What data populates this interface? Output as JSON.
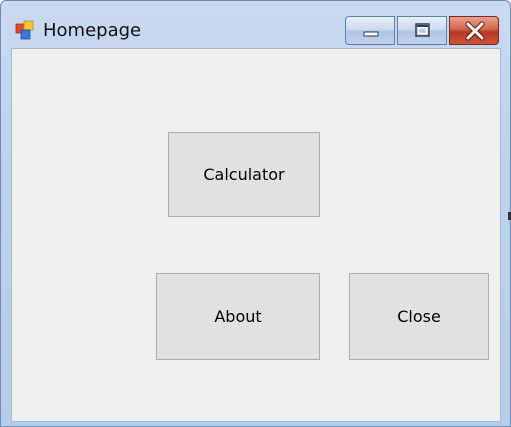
{
  "window": {
    "title": "Homepage"
  },
  "titlebar": {
    "icon": "app-windows-icon",
    "minimize_icon": "minimize-icon",
    "maximize_icon": "maximize-icon",
    "close_icon": "close-icon"
  },
  "buttons": {
    "calculator": "Calculator",
    "about": "About",
    "close": "Close"
  },
  "colors": {
    "client_background": "#f0f0f0",
    "button_face": "#e1e1e1",
    "button_border": "#adadad",
    "close_button_red": "#c8553c"
  }
}
